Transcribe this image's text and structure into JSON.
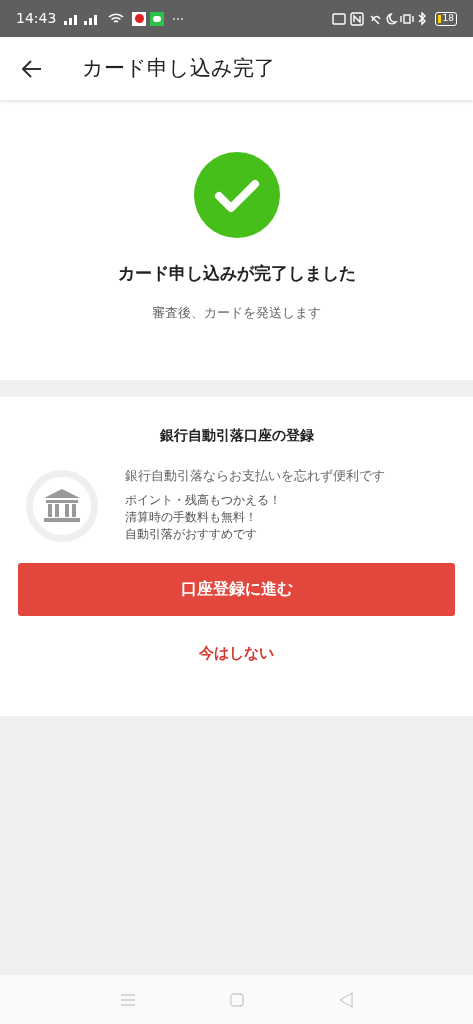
{
  "status_bar": {
    "time": "14:43",
    "battery": "18"
  },
  "header": {
    "title": "カード申し込み完了"
  },
  "success": {
    "title": "カード申し込みが完了しました",
    "message": "審査後、カードを発送します"
  },
  "bank_registration": {
    "title": "銀行自動引落口座の登録",
    "lead": "銀行自動引落ならお支払いを忘れず便利です",
    "points": [
      "ポイント・残高もつかえる！",
      "清算時の手数料も無料！",
      "自動引落がおすすめです"
    ],
    "primary_button": "口座登録に進む",
    "secondary_button": "今はしない"
  }
}
